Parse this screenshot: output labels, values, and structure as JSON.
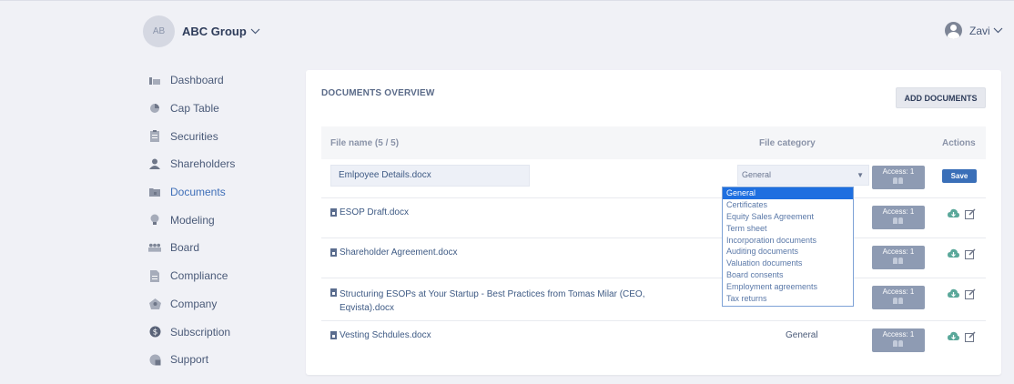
{
  "header": {
    "company_initials": "AB",
    "company_name": "ABC Group",
    "user_name": "Zavi"
  },
  "sidebar": {
    "items": [
      {
        "label": "Dashboard",
        "icon": "dashboard-icon"
      },
      {
        "label": "Cap Table",
        "icon": "pie-chart-icon"
      },
      {
        "label": "Securities",
        "icon": "clipboard-icon"
      },
      {
        "label": "Shareholders",
        "icon": "person-icon"
      },
      {
        "label": "Documents",
        "icon": "folder-icon",
        "active": true
      },
      {
        "label": "Modeling",
        "icon": "lightbulb-icon"
      },
      {
        "label": "Board",
        "icon": "group-icon"
      },
      {
        "label": "Compliance",
        "icon": "document-icon"
      },
      {
        "label": "Company",
        "icon": "building-icon"
      },
      {
        "label": "Subscription",
        "icon": "dollar-icon"
      },
      {
        "label": "Support",
        "icon": "support-icon"
      }
    ]
  },
  "documents": {
    "title": "DOCUMENTS OVERVIEW",
    "add_button": "ADD DOCUMENTS",
    "columns": {
      "file_name": "File name (5 / 5)",
      "file_category": "File category",
      "actions": "Actions"
    },
    "editing_row": {
      "file_name_value": "Emlpoyee Details.docx",
      "category_value": "General",
      "access_label": "Access: 1",
      "save_label": "Save"
    },
    "rows": [
      {
        "name": "ESOP Draft.docx",
        "category": "",
        "access": "Access: 1"
      },
      {
        "name": "Shareholder Agreement.docx",
        "category": "",
        "access": "Access: 1"
      },
      {
        "name": "Structuring ESOPs at Your Startup - Best Practices from Tomas Milar (CEO,",
        "name_line2": "Eqvista).docx",
        "category": "",
        "access": "Access: 1"
      },
      {
        "name": "Vesting Schdules.docx",
        "category": "General",
        "access": "Access: 1"
      }
    ],
    "category_options": [
      "General",
      "Certificates",
      "Equity Sales Agreement",
      "Term sheet",
      "Incorporation documents",
      "Auditing documents",
      "Valuation documents",
      "Board consents",
      "Employment agreements",
      "Tax returns"
    ]
  },
  "colors": {
    "accent": "#3a6fb8",
    "access_button": "#8e9bb3",
    "download_icon": "#5aa89a",
    "dropdown_selected": "#1e6fe0"
  }
}
